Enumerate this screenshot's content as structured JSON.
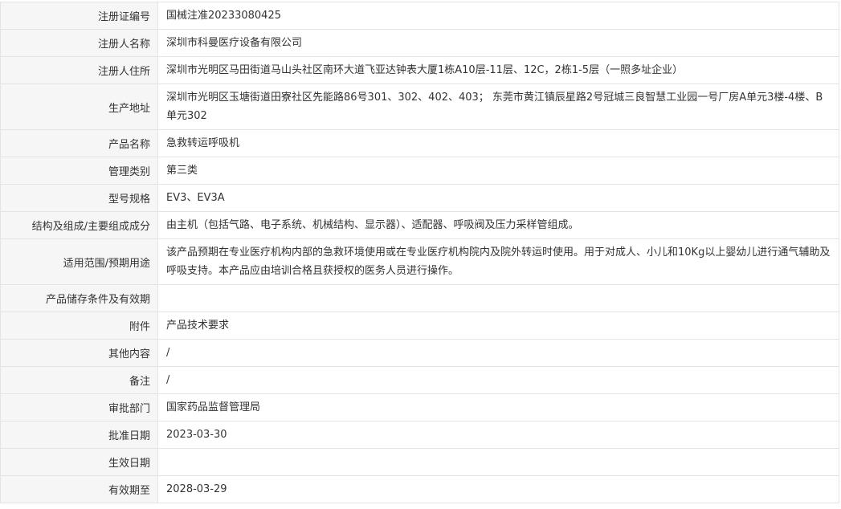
{
  "rows": [
    {
      "label": "注册证编号",
      "value": "国械注准20233080425"
    },
    {
      "label": "注册人名称",
      "value": "深圳市科曼医疗设备有限公司"
    },
    {
      "label": "注册人住所",
      "value": "深圳市光明区马田街道马山头社区南环大道飞亚达钟表大厦1栋A10层-11层、12C，2栋1-5层（一照多址企业）"
    },
    {
      "label": "生产地址",
      "value": "深圳市光明区玉塘街道田寮社区先能路86号301、302、402、403； 东莞市黄江镇辰星路2号冠城三良智慧工业园一号厂房A单元3楼-4楼、B单元302"
    },
    {
      "label": "产品名称",
      "value": "急救转运呼吸机"
    },
    {
      "label": "管理类别",
      "value": "第三类"
    },
    {
      "label": "型号规格",
      "value": "EV3、EV3A"
    },
    {
      "label": "结构及组成/主要组成成分",
      "value": "由主机（包括气路、电子系统、机械结构、显示器）、适配器、呼吸阀及压力采样管组成。"
    },
    {
      "label": "适用范围/预期用途",
      "value": "该产品预期在专业医疗机构内部的急救环境使用或在专业医疗机构院内及院外转运时使用。用于对成人、小儿和10Kg以上婴幼儿进行通气辅助及呼吸支持。本产品应由培训合格且获授权的医务人员进行操作。"
    },
    {
      "label": "产品储存条件及有效期",
      "value": ""
    },
    {
      "label": "附件",
      "value": "产品技术要求"
    },
    {
      "label": "其他内容",
      "value": "/"
    },
    {
      "label": "备注",
      "value": "/"
    },
    {
      "label": "审批部门",
      "value": "国家药品监督管理局"
    },
    {
      "label": "批准日期",
      "value": "2023-03-30"
    },
    {
      "label": "生效日期",
      "value": ""
    },
    {
      "label": "有效期至",
      "value": "2028-03-29"
    }
  ]
}
